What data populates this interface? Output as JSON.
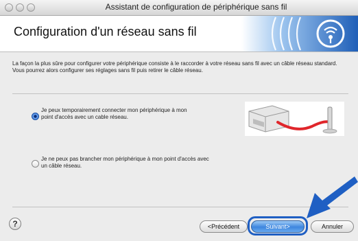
{
  "window": {
    "title": "Assistant de configuration de périphérique sans fil"
  },
  "header": {
    "title": "Configuration d'un réseau sans fil",
    "logo_icon": "wireless-signal-icon"
  },
  "intro": {
    "text": "La façon la plus sûre pour configurer votre périphérique consiste à le raccorder à votre réseau sans fil avec un câble réseau standard. Vous pourrez alors configurer ses réglages sans fil puis retirer le câble réseau."
  },
  "options": [
    {
      "label": "Je peux temporairement connecter mon périphérique à mon point d'accès avec un cable réseau.",
      "selected": true
    },
    {
      "label": "Je ne peux pas brancher mon périphérique à mon point d'accès avec un câble réseau.",
      "selected": false
    }
  ],
  "buttons": {
    "help": "?",
    "previous": "<Précédent",
    "next": "Suivant>",
    "cancel": "Annuler"
  },
  "colors": {
    "accent": "#3e86de",
    "highlight": "#1f5fc3",
    "cable": "#e0262b"
  }
}
